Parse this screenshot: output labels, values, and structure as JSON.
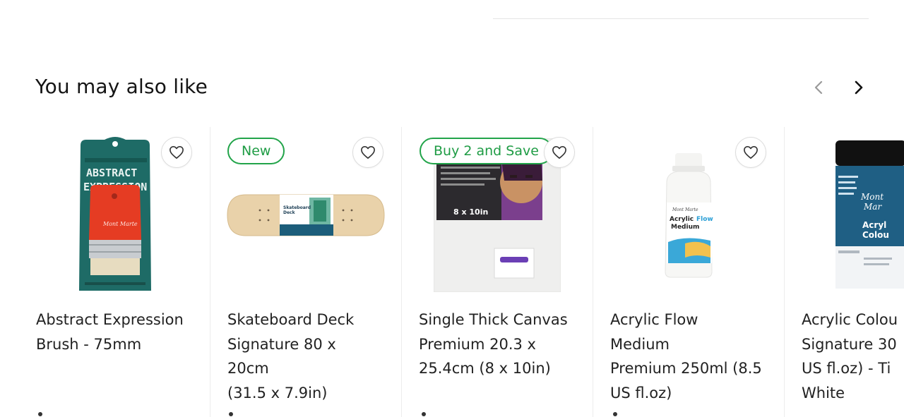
{
  "section": {
    "title": "You may also like"
  },
  "navigation": {
    "prev_icon": "chevron-left-icon",
    "next_icon": "chevron-right-icon"
  },
  "colors": {
    "badge_green": "#22a44a",
    "text": "#222222",
    "divider": "#ececec",
    "brand_teal": "#1e6b66"
  },
  "products": [
    {
      "name_lines": [
        "Abstract Expression",
        "Brush - 75mm"
      ],
      "badge": "",
      "image": "brush-package-image",
      "wishlist_icon": "heart-icon"
    },
    {
      "name_lines": [
        "Skateboard Deck",
        "Signature 80 x 20cm",
        "(31.5 x 7.9in)"
      ],
      "badge": "New",
      "image": "skateboard-deck-image",
      "wishlist_icon": "heart-icon"
    },
    {
      "name_lines": [
        "Single Thick Canvas",
        "Premium 20.3 x",
        "25.4cm (8 x 10in)"
      ],
      "badge": "Buy 2 and Save",
      "image": "canvas-image",
      "image_text": "8 x 10in",
      "wishlist_icon": "heart-icon"
    },
    {
      "name_lines": [
        "Acrylic Flow Medium",
        "Premium 250ml (8.5",
        "US fl.oz)"
      ],
      "badge": "",
      "image": "acrylic-flow-bottle-image",
      "image_text": "Acrylic Flow Medium",
      "wishlist_icon": "heart-icon"
    },
    {
      "name_lines": [
        "Acrylic Colou",
        "Signature 30",
        "US fl.oz) - Ti",
        "White"
      ],
      "badge": "",
      "image": "acrylic-colour-tub-image",
      "image_text": "Acrylic Colour",
      "wishlist_icon": "heart-icon"
    }
  ]
}
